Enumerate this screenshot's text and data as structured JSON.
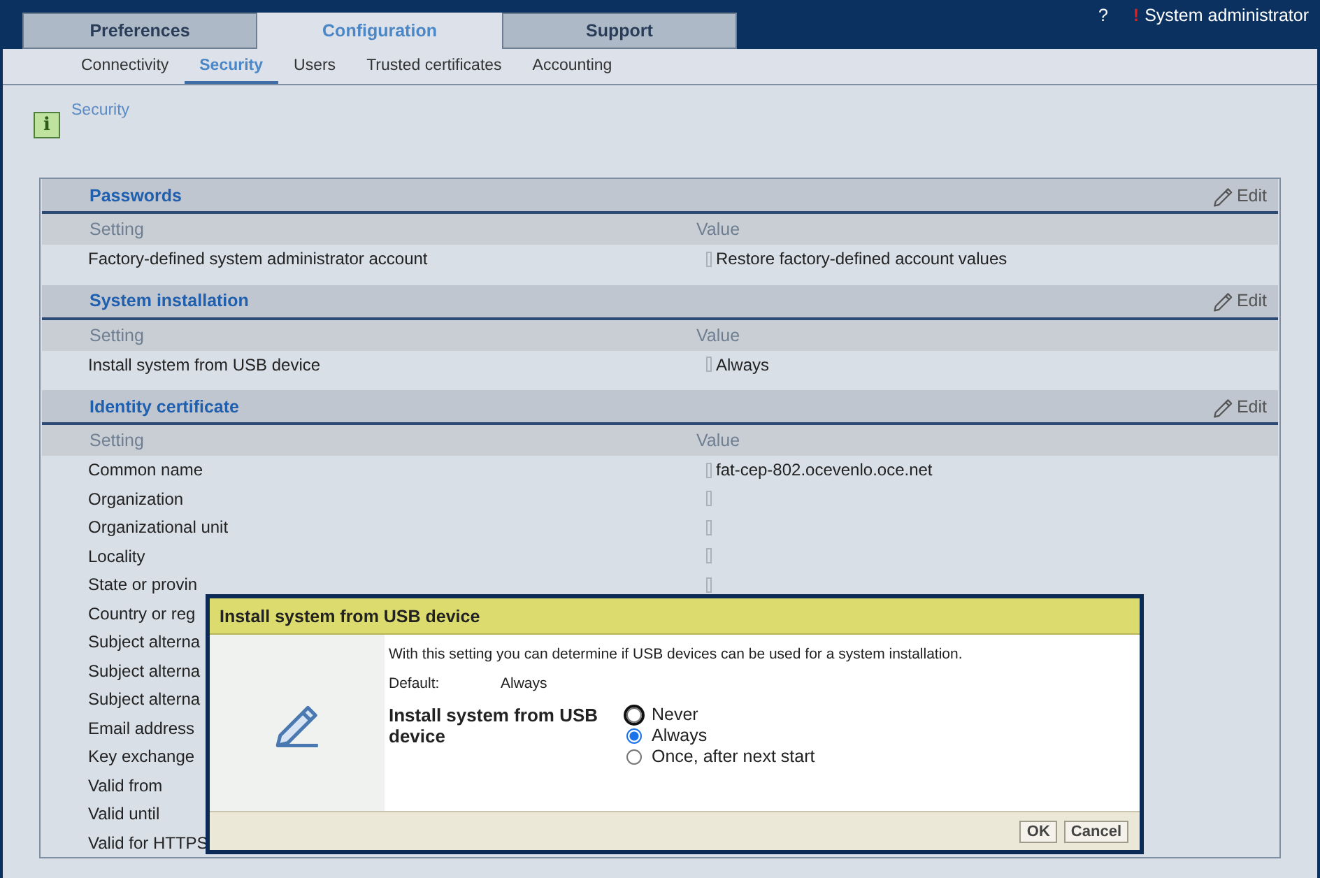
{
  "top_tabs": [
    {
      "label": "Preferences",
      "selected": false
    },
    {
      "label": "Configuration",
      "selected": true
    },
    {
      "label": "Support",
      "selected": false
    }
  ],
  "help": "?",
  "user": {
    "alert": "!",
    "name": "System administrator"
  },
  "sub_tabs": [
    {
      "label": "Connectivity",
      "selected": false
    },
    {
      "label": "Security",
      "selected": true
    },
    {
      "label": "Users",
      "selected": false
    },
    {
      "label": "Trusted certificates",
      "selected": false
    },
    {
      "label": "Accounting",
      "selected": false
    }
  ],
  "info_glyph": "i",
  "page_title": "Security",
  "sections": [
    {
      "title": "Passwords",
      "edit": "Edit",
      "columns": [
        "Setting",
        "Value"
      ],
      "rows": [
        {
          "setting": "Factory-defined system administrator account",
          "value": "Restore factory-defined account values"
        }
      ]
    },
    {
      "title": "System installation",
      "edit": "Edit",
      "columns": [
        "Setting",
        "Value"
      ],
      "rows": [
        {
          "setting": "Install system from USB device",
          "value": "Always"
        }
      ]
    },
    {
      "title": "Identity certificate",
      "edit": "Edit",
      "columns": [
        "Setting",
        "Value"
      ],
      "rows": [
        {
          "setting": "Common name",
          "value": "fat-cep-802.ocevenlo.oce.net"
        },
        {
          "setting": "Organization"
        },
        {
          "setting": "Organizational unit"
        },
        {
          "setting": "Locality"
        },
        {
          "setting": "State or provin"
        },
        {
          "setting": "Country or reg"
        },
        {
          "setting": "Subject alterna"
        },
        {
          "setting": "Subject alterna"
        },
        {
          "setting": "Subject alterna"
        },
        {
          "setting": "Email address"
        },
        {
          "setting": "Key exchange"
        },
        {
          "setting": "Valid from"
        },
        {
          "setting": "Valid until"
        },
        {
          "setting": "Valid for HTTPS"
        }
      ]
    }
  ],
  "dialog": {
    "title": "Install system from USB device",
    "description": "With this setting you can determine if USB devices can be used for a system installation.",
    "default_label": "Default:",
    "default_value": "Always",
    "field_label": "Install system from USB device",
    "options": [
      {
        "label": "Never",
        "selected": false,
        "focused": true
      },
      {
        "label": "Always",
        "selected": true,
        "focused": false
      },
      {
        "label": "Once, after next start",
        "selected": false,
        "focused": false
      }
    ],
    "buttons": [
      "OK",
      "Cancel"
    ]
  }
}
